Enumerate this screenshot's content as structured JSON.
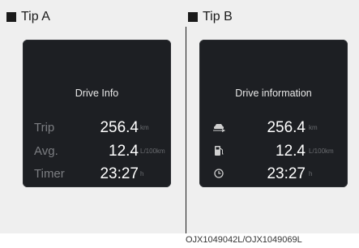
{
  "tip_a": {
    "label": "Tip A",
    "screen": {
      "title": "Drive Info",
      "rows": [
        {
          "label": "Trip",
          "value": "256.4",
          "unit": "km"
        },
        {
          "label": "Avg.",
          "value": "12.4",
          "unit": "L/100km"
        },
        {
          "label": "Timer",
          "value": "23:27",
          "unit": "h"
        }
      ]
    }
  },
  "tip_b": {
    "label": "Tip B",
    "screen": {
      "title": "Drive information",
      "rows": [
        {
          "icon": "car-trip-icon",
          "value": "256.4",
          "unit": "km"
        },
        {
          "icon": "fuel-pump-icon",
          "value": "12.4",
          "unit": "L/100km"
        },
        {
          "icon": "clock-icon",
          "value": "23:27",
          "unit": "h"
        }
      ]
    }
  },
  "footer": {
    "code": "OJX1049042L/OJX1049069L"
  },
  "colors": {
    "screen_bg": "#1d1f23",
    "panel_bg": "#efefef",
    "value": "#ffffff",
    "label": "#7c7e82"
  }
}
